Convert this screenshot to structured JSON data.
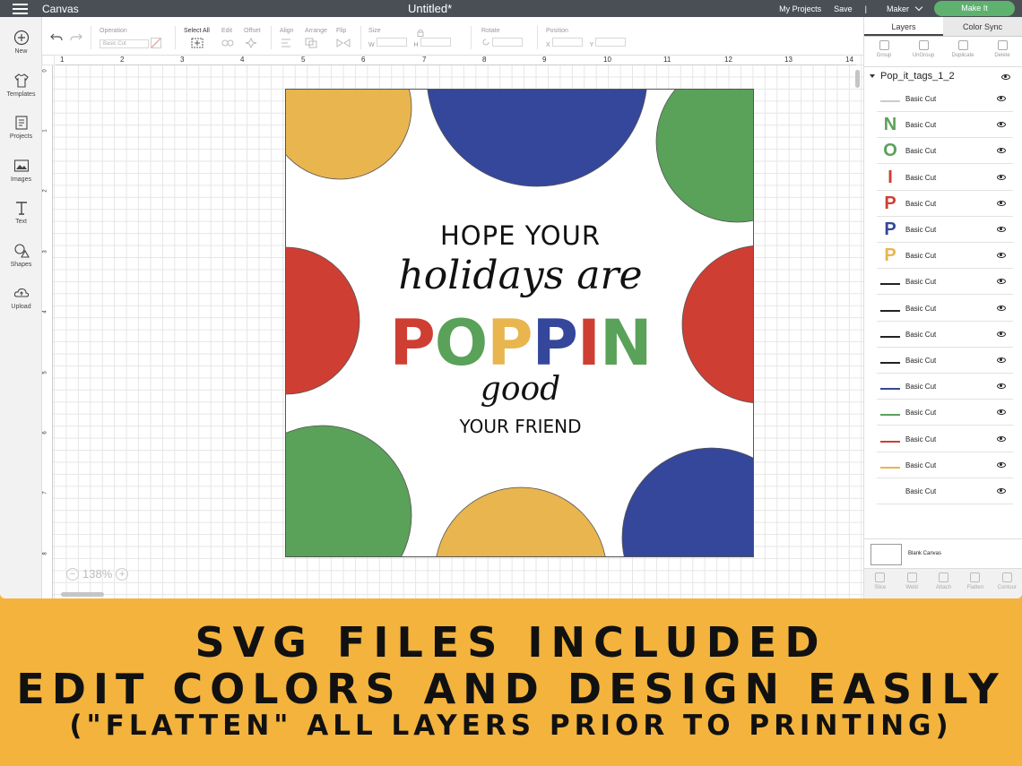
{
  "topbar": {
    "app_title": "Canvas",
    "doc_title": "Untitled*",
    "my_projects": "My Projects",
    "save": "Save",
    "separator": "|",
    "machine": "Maker",
    "make_it": "Make It"
  },
  "sidebar": {
    "items": [
      {
        "label": "New",
        "icon": "plus-circle-icon"
      },
      {
        "label": "Templates",
        "icon": "shirt-icon"
      },
      {
        "label": "Projects",
        "icon": "projects-icon"
      },
      {
        "label": "Images",
        "icon": "image-icon"
      },
      {
        "label": "Text",
        "icon": "text-icon"
      },
      {
        "label": "Shapes",
        "icon": "shapes-icon"
      },
      {
        "label": "Upload",
        "icon": "upload-cloud-icon"
      }
    ]
  },
  "toolbar": {
    "operation_label": "Operation",
    "operation_value": "Basic Cut",
    "select_all": "Select All",
    "edit": "Edit",
    "offset": "Offset",
    "align": "Align",
    "arrange": "Arrange",
    "flip": "Flip",
    "size": "Size",
    "w": "W",
    "h": "H",
    "rotate": "Rotate",
    "position": "Position",
    "x": "X",
    "y": "Y"
  },
  "rulers": {
    "top": [
      "1",
      "2",
      "3",
      "4",
      "5",
      "6",
      "7",
      "8",
      "9",
      "10",
      "11",
      "12",
      "13",
      "14"
    ],
    "left": [
      "0",
      "1",
      "2",
      "3",
      "4",
      "5",
      "6",
      "7",
      "8"
    ]
  },
  "design": {
    "line1": "HOPE YOUR",
    "line2": "holidays are",
    "poppin_letters": [
      "P",
      "O",
      "P",
      "P",
      "I",
      "N"
    ],
    "line4": "good",
    "line5": "YOUR FRIEND"
  },
  "zoom": {
    "value": "138%",
    "minus": "−",
    "plus": "+"
  },
  "panel": {
    "tab_layers": "Layers",
    "tab_color_sync": "Color Sync",
    "tools": [
      "Group",
      "UnGroup",
      "Duplicate",
      "Delete"
    ],
    "group_name": "Pop_it_tags_1_2",
    "layers": [
      {
        "name": "Basic Cut",
        "thumb": "",
        "thumb_color": "#cccccc"
      },
      {
        "name": "Basic Cut",
        "thumb": "N",
        "thumb_color": "#5aa15a"
      },
      {
        "name": "Basic Cut",
        "thumb": "O",
        "thumb_color": "#5aa15a"
      },
      {
        "name": "Basic Cut",
        "thumb": "I",
        "thumb_color": "#cf3e33"
      },
      {
        "name": "Basic Cut",
        "thumb": "P",
        "thumb_color": "#cf3e33"
      },
      {
        "name": "Basic Cut",
        "thumb": "P",
        "thumb_color": "#34479a"
      },
      {
        "name": "Basic Cut",
        "thumb": "P",
        "thumb_color": "#e8b54f"
      },
      {
        "name": "Basic Cut",
        "thumb": "",
        "thumb_color": "#222222"
      },
      {
        "name": "Basic Cut",
        "thumb": "",
        "thumb_color": "#222222"
      },
      {
        "name": "Basic Cut",
        "thumb": "",
        "thumb_color": "#222222"
      },
      {
        "name": "Basic Cut",
        "thumb": "",
        "thumb_color": "#222222"
      },
      {
        "name": "Basic Cut",
        "thumb": "",
        "thumb_color": "#34479a"
      },
      {
        "name": "Basic Cut",
        "thumb": "",
        "thumb_color": "#5aa15a"
      },
      {
        "name": "Basic Cut",
        "thumb": "",
        "thumb_color": "#cf3e33"
      },
      {
        "name": "Basic Cut",
        "thumb": "",
        "thumb_color": "#e8b54f"
      },
      {
        "name": "Basic Cut",
        "thumb": "",
        "thumb_color": "#ffffff"
      }
    ],
    "blank_canvas": "Blank Canvas",
    "bottom_tools": [
      "Slice",
      "Weld",
      "Attach",
      "Flatten",
      "Contour"
    ]
  },
  "banner": {
    "line1": "SVG FILES INCLUDED",
    "line2": "EDIT COLORS AND DESIGN EASILY",
    "line3": "(\"FLATTEN\" ALL LAYERS PRIOR TO PRINTING)"
  },
  "colors": {
    "yellow": "#e8b54f",
    "blue": "#34479a",
    "green": "#5aa15a",
    "red": "#cf3e33",
    "banner": "#f3b33d",
    "make_it": "#5fb16f"
  }
}
